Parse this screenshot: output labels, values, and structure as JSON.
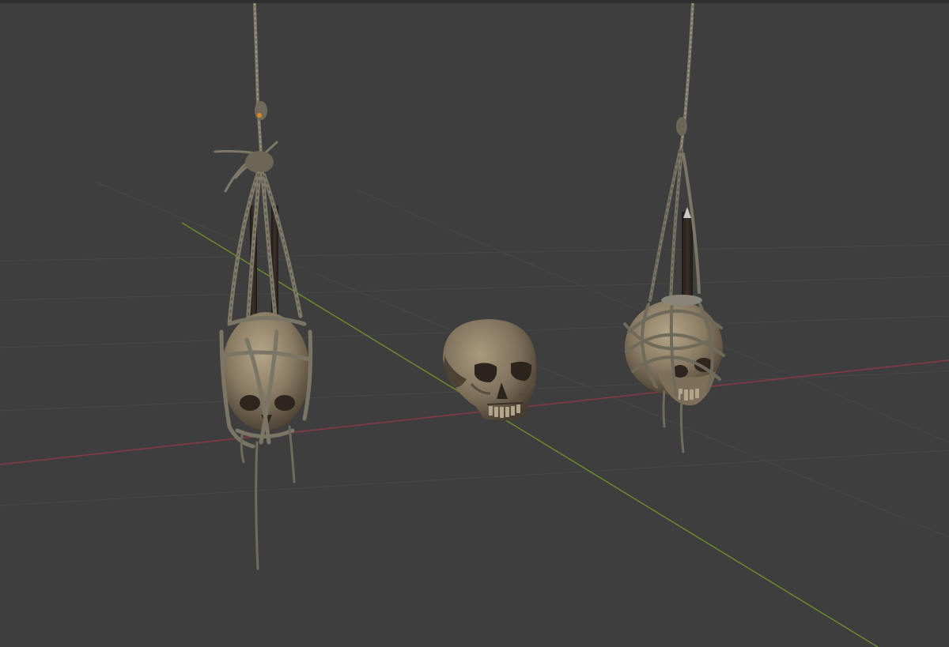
{
  "viewport": {
    "background_color": "#3e3e3e",
    "grid_color": "#454545",
    "x_axis_color": "#8a3a45",
    "y_axis_color": "#6d8a2c"
  },
  "objects": [
    {
      "name": "hanging-skull-left-icon",
      "material": "bone",
      "bound_with": "rope"
    },
    {
      "name": "skull-center-icon",
      "material": "bone",
      "bound_with": "none"
    },
    {
      "name": "hanging-skull-right-icon",
      "material": "bone",
      "bound_with": "rope"
    }
  ],
  "colors": {
    "bone_light": "#a39278",
    "bone_mid": "#857660",
    "bone_dark": "#4d4335",
    "rope": "#7d7868",
    "rope_dark": "#55503f",
    "stick": "#2b2520",
    "origin_marker": "#e08a1a"
  }
}
